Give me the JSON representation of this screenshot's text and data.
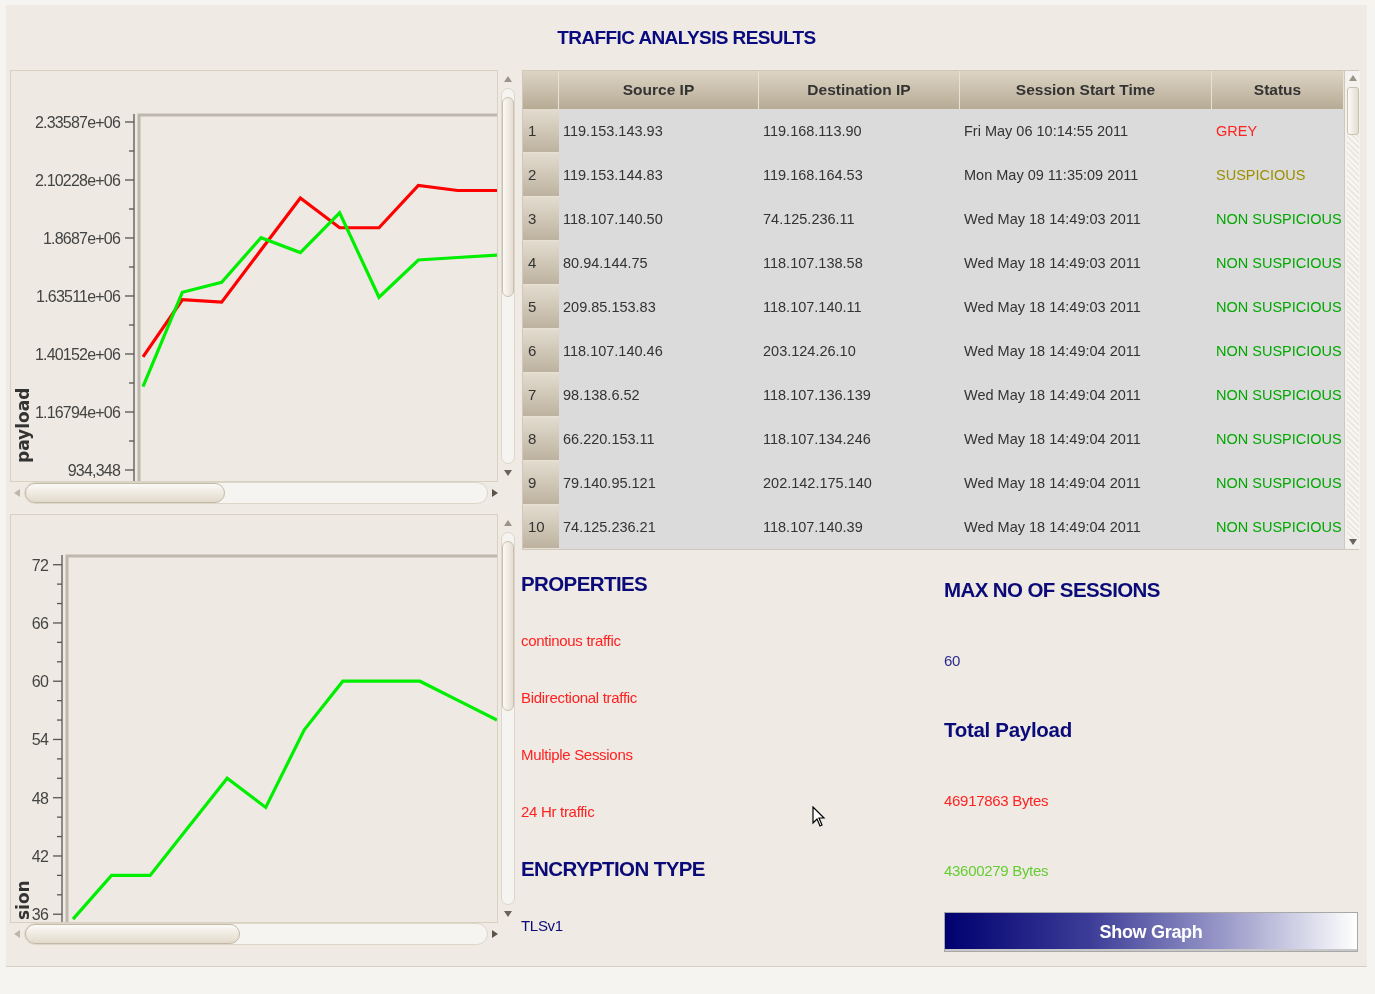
{
  "title": "TRAFFIC ANALYSIS RESULTS",
  "charts": [
    {
      "chart_data": {
        "type": "line",
        "ylabel": "payload",
        "categories": [
          null,
          null,
          null,
          null,
          null,
          null,
          null,
          null,
          null,
          null
        ],
        "ylim": [
          890000,
          2368000
        ],
        "yticks": [
          {
            "value": 2335870,
            "label": "2.33587e+06"
          },
          {
            "value": 2102280,
            "label": "2.10228e+06"
          },
          {
            "value": 1868700,
            "label": "1.8687e+06"
          },
          {
            "value": 1635110,
            "label": "1.63511e+06"
          },
          {
            "value": 1401520,
            "label": "1.40152e+06"
          },
          {
            "value": 1167940,
            "label": "1.16794e+06"
          },
          {
            "value": 934348,
            "label": "934,348"
          }
        ],
        "series": [
          {
            "color": "#ff0000",
            "values": [
              1390000,
              1620000,
              1610000,
              1820000,
              2030000,
              1910000,
              1910000,
              2080000,
              2060000,
              2060000
            ]
          },
          {
            "color": "#00ee00",
            "values": [
              1270000,
              1650000,
              1690000,
              1870000,
              1810000,
              1970000,
              1630000,
              1780000,
              1790000,
              1800000
            ]
          }
        ]
      }
    },
    {
      "chart_data": {
        "type": "line",
        "ylabel": "sion",
        "categories": [
          null,
          null,
          null,
          null,
          null,
          null,
          null,
          null,
          null,
          null,
          null,
          null
        ],
        "ylim": [
          35.2,
          73
        ],
        "yticks": [
          {
            "value": 72,
            "label": "72"
          },
          {
            "value": 66,
            "label": "66"
          },
          {
            "value": 60,
            "label": "60"
          },
          {
            "value": 54,
            "label": "54"
          },
          {
            "value": 48,
            "label": "48"
          },
          {
            "value": 42,
            "label": "42"
          },
          {
            "value": 36,
            "label": "36"
          }
        ],
        "series": [
          {
            "color": "#00ee00",
            "values": [
              35.5,
              40,
              40,
              45,
              50,
              47,
              55,
              60,
              60,
              60,
              58,
              56
            ]
          }
        ]
      }
    }
  ],
  "table": {
    "columns": [
      "Source IP",
      "Destination IP",
      "Session Start Time",
      "Status"
    ],
    "rows": [
      {
        "number": "1",
        "source_ip": "119.153.143.93",
        "destination_ip": "119.168.113.90",
        "start_time": "Fri May 06 10:14:55 2011",
        "status": "GREY",
        "color": "#ff2222"
      },
      {
        "number": "2",
        "source_ip": "119.153.144.83",
        "destination_ip": "119.168.164.53",
        "start_time": "Mon May 09 11:35:09 2011",
        "status": "SUSPICIOUS",
        "color": "#9c8f00"
      },
      {
        "number": "3",
        "source_ip": "118.107.140.50",
        "destination_ip": "74.125.236.11",
        "start_time": "Wed May 18 14:49:03 2011",
        "status": "NON SUSPICIOUS",
        "color": "#00a800"
      },
      {
        "number": "4",
        "source_ip": "80.94.144.75",
        "destination_ip": "118.107.138.58",
        "start_time": "Wed May 18 14:49:03 2011",
        "status": "NON SUSPICIOUS",
        "color": "#00a800"
      },
      {
        "number": "5",
        "source_ip": "209.85.153.83",
        "destination_ip": "118.107.140.11",
        "start_time": "Wed May 18 14:49:03 2011",
        "status": "NON SUSPICIOUS",
        "color": "#00a800"
      },
      {
        "number": "6",
        "source_ip": "118.107.140.46",
        "destination_ip": "203.124.26.10",
        "start_time": "Wed May 18 14:49:04 2011",
        "status": "NON SUSPICIOUS",
        "color": "#00a800"
      },
      {
        "number": "7",
        "source_ip": "98.138.6.52",
        "destination_ip": "118.107.136.139",
        "start_time": "Wed May 18 14:49:04 2011",
        "status": "NON SUSPICIOUS",
        "color": "#00a800"
      },
      {
        "number": "8",
        "source_ip": "66.220.153.11",
        "destination_ip": "118.107.134.246",
        "start_time": "Wed May 18 14:49:04 2011",
        "status": "NON SUSPICIOUS",
        "color": "#00a800"
      },
      {
        "number": "9",
        "source_ip": "79.140.95.121",
        "destination_ip": "202.142.175.140",
        "start_time": "Wed May 18 14:49:04 2011",
        "status": "NON SUSPICIOUS",
        "color": "#00a800"
      },
      {
        "number": "10",
        "source_ip": "74.125.236.21",
        "destination_ip": "118.107.140.39",
        "start_time": "Wed May 18 14:49:04 2011",
        "status": "NON SUSPICIOUS",
        "color": "#00a800"
      }
    ]
  },
  "properties": {
    "heading": "PROPERTIES",
    "items": [
      "continous traffic",
      "Bidirectional traffic",
      "Multiple Sessions",
      "24 Hr traffic"
    ]
  },
  "encryption": {
    "heading": "ENCRYPTION TYPE",
    "value": "TLSv1"
  },
  "max_sessions": {
    "heading": "MAX NO OF SESSIONS",
    "value": "60"
  },
  "total_payload": {
    "heading": "Total Payload",
    "values": [
      {
        "text": "46917863 Bytes",
        "color": "#ff2222"
      },
      {
        "text": "43600279 Bytes",
        "color": "#66cc33"
      }
    ]
  },
  "show_graph_button": "Show Graph"
}
